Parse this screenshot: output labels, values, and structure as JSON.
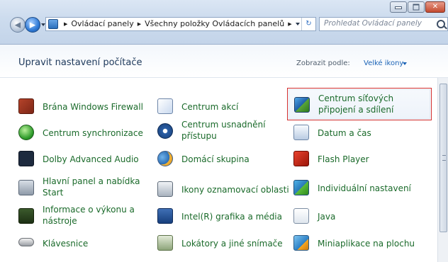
{
  "window": {
    "colors": {
      "title_bar": "#c9d9ee",
      "close_button": "#c44a2f",
      "link_green": "#1a6a2a",
      "link_blue": "#1b63b6",
      "selection_border": "#d32f2f"
    }
  },
  "address_bar": {
    "crumbs": [
      "Ovládací panely",
      "Všechny položky Ovládacích panelů"
    ]
  },
  "search": {
    "placeholder": "Prohledat Ovládací panely"
  },
  "header": {
    "title": "Upravit nastavení počítače",
    "view_by_label": "Zobrazit podle:",
    "view_by_value": "Velké ikony"
  },
  "items": {
    "col1": [
      {
        "label": "Brána Windows Firewall",
        "icon": "firewall-icon"
      },
      {
        "label": "Centrum synchronizace",
        "icon": "sync-center-icon"
      },
      {
        "label": "Dolby Advanced Audio",
        "icon": "dolby-icon"
      },
      {
        "label": "Hlavní panel a nabídka Start",
        "icon": "taskbar-icon"
      },
      {
        "label": "Informace o výkonu a nástroje",
        "icon": "performance-icon"
      },
      {
        "label": "Klávesnice",
        "icon": "keyboard-icon"
      }
    ],
    "col2": [
      {
        "label": "Centrum akcí",
        "icon": "action-center-flag-icon"
      },
      {
        "label": "Centrum usnadnění přístupu",
        "icon": "ease-of-access-icon"
      },
      {
        "label": "Domácí skupina",
        "icon": "homegroup-icon"
      },
      {
        "label": "Ikony oznamovací oblasti",
        "icon": "notification-area-icon"
      },
      {
        "label": "Intel(R) grafika a média",
        "icon": "intel-graphics-icon"
      },
      {
        "label": "Lokátory a jiné snímače",
        "icon": "sensors-icon"
      }
    ],
    "col3": [
      {
        "label": "Centrum síťových připojení a sdílení",
        "icon": "network-center-icon",
        "selected": true
      },
      {
        "label": "Datum a čas",
        "icon": "date-time-icon"
      },
      {
        "label": "Flash Player",
        "icon": "flash-player-icon"
      },
      {
        "label": "Individuální nastavení",
        "icon": "personalization-icon"
      },
      {
        "label": "Java",
        "icon": "java-icon"
      },
      {
        "label": "Miniaplikace na plochu",
        "icon": "gadgets-icon"
      }
    ]
  }
}
